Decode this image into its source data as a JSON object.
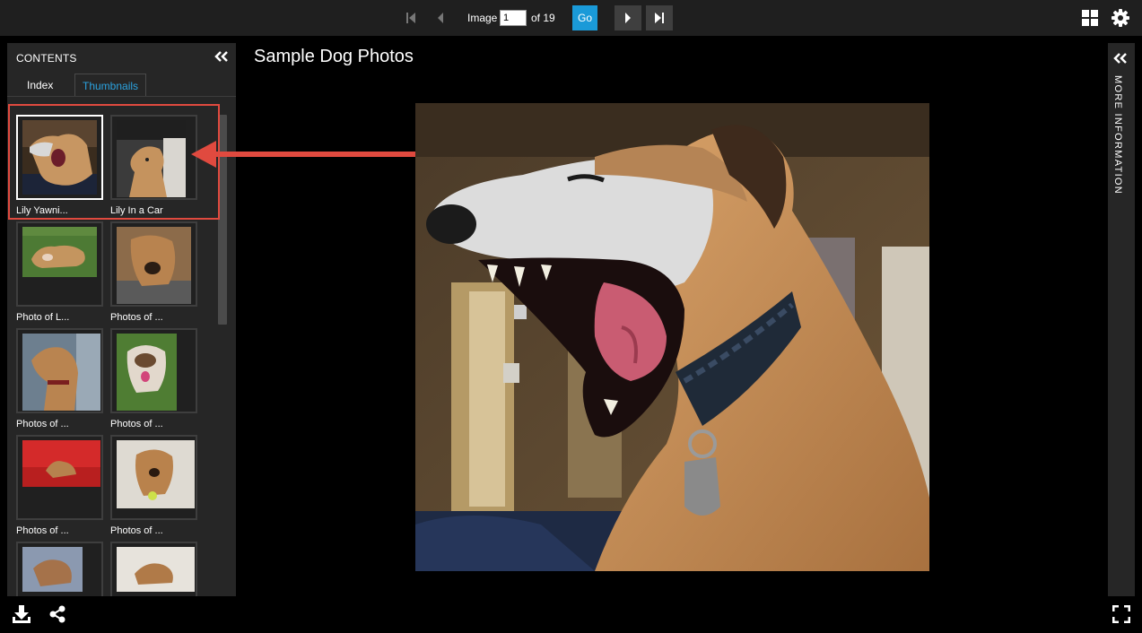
{
  "toolbar": {
    "image_label": "Image",
    "current_image": "1",
    "of_label": "of 19",
    "go_label": "Go",
    "icons": [
      "first-page-icon",
      "previous-icon",
      "next-icon",
      "last-page-icon",
      "grid-view-icon",
      "settings-gear-icon"
    ]
  },
  "contents_panel": {
    "title": "CONTENTS",
    "tabs": [
      {
        "label": "Index",
        "active": false
      },
      {
        "label": "Thumbnails",
        "active": true
      }
    ],
    "thumbnails": [
      {
        "caption": "Lily Yawni...",
        "selected": true
      },
      {
        "caption": "Lily In a Car",
        "selected": false
      },
      {
        "caption": "Photo of L...",
        "selected": false
      },
      {
        "caption": "Photos of ...",
        "selected": false
      },
      {
        "caption": "Photos of ...",
        "selected": false
      },
      {
        "caption": "Photos of ...",
        "selected": false
      },
      {
        "caption": "Photos of ...",
        "selected": false
      },
      {
        "caption": "Photos of ...",
        "selected": false
      },
      {
        "caption": "",
        "selected": false
      },
      {
        "caption": "",
        "selected": false
      }
    ]
  },
  "main": {
    "title": "Sample Dog Photos"
  },
  "info_panel": {
    "label": "MORE INFORMATION"
  },
  "bottom_bar": {
    "icons": [
      "download-icon",
      "share-icon",
      "fullscreen-icon"
    ]
  },
  "colors": {
    "accent": "#1a9ad8",
    "highlight": "#e04a3f",
    "panel": "#262626",
    "toolbar": "#1f1f1f"
  }
}
